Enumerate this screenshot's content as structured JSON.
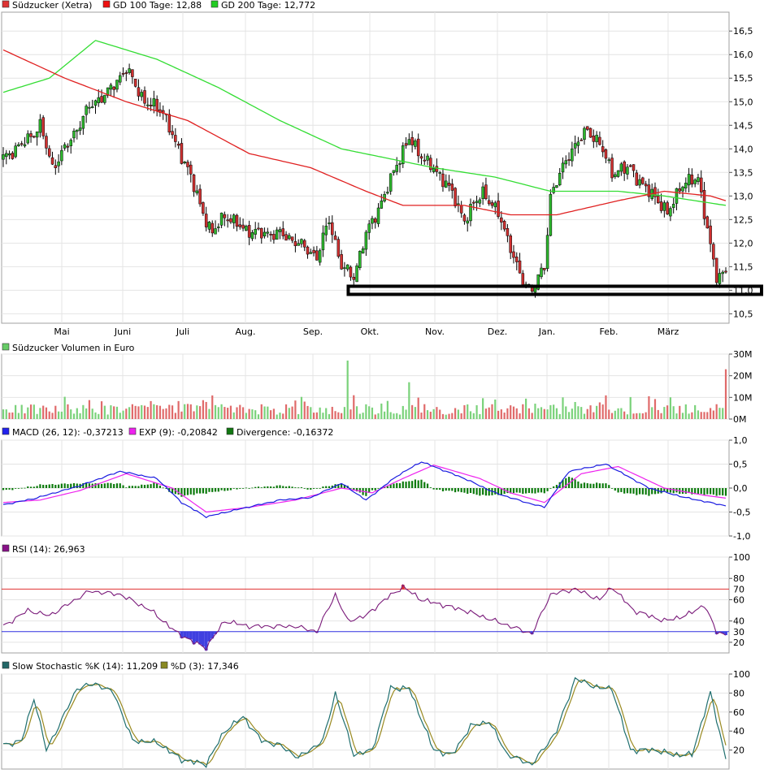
{
  "colors": {
    "price_up": "#2db82d",
    "price_down": "#d03030",
    "gd100": "#e02020",
    "gd200": "#33dd33",
    "macd": "#1a1ae0",
    "exp": "#ee22ee",
    "divergence": "#0b7a0b",
    "rsi": "#7a1a7a",
    "rsi_fill_low": "#4040e0",
    "rsi_fill_high": "#e03030",
    "stoch_k": "#1f6f6f",
    "stoch_d": "#9a8a20",
    "grid": "#e4e4e4",
    "frame": "#a0a0a0"
  },
  "legends": {
    "price": [
      {
        "swatch": "#dd3333",
        "text": "Südzucker (Xetra)"
      },
      {
        "swatch": "#ee1111",
        "text": "GD 100 Tage: 12,88"
      },
      {
        "swatch": "#22cc22",
        "text": "GD 200 Tage: 12,772"
      }
    ],
    "volume": [
      {
        "swatch": "#66cc66",
        "text": "Südzucker Volumen in Euro"
      }
    ],
    "macd": [
      {
        "swatch": "#2222ee",
        "text": "MACD (26, 12): -0,37213"
      },
      {
        "swatch": "#ee22ee",
        "text": "EXP (9): -0,20842"
      },
      {
        "swatch": "#117711",
        "text": "Divergence: -0,16372"
      }
    ],
    "rsi": [
      {
        "swatch": "#881188",
        "text": "RSI (14): 26,963"
      }
    ],
    "stoch": [
      {
        "swatch": "#226666",
        "text": "Slow Stochastic %K (14): 11,209"
      },
      {
        "swatch": "#888822",
        "text": "%D (3): 17,346"
      }
    ]
  },
  "chart_data": [
    {
      "type": "candlestick",
      "title": "Südzucker (Xetra)",
      "x_months": [
        "Mai",
        "Juni",
        "Juli",
        "Aug.",
        "Sep.",
        "Okt.",
        "Nov.",
        "Dez.",
        "Jan.",
        "Feb.",
        "März"
      ],
      "ylim": [
        10.3,
        16.9
      ],
      "y_ticks": [
        "10,5",
        "11,0",
        "11,5",
        "12,0",
        "12,5",
        "13,0",
        "13,5",
        "14,0",
        "14,5",
        "15,0",
        "15,5",
        "16,0",
        "16,5"
      ],
      "grid": true,
      "price_anchors": [
        [
          0,
          13.8
        ],
        [
          8,
          14.2
        ],
        [
          12,
          14.5
        ],
        [
          16,
          13.6
        ],
        [
          22,
          14.2
        ],
        [
          28,
          14.9
        ],
        [
          34,
          15.2
        ],
        [
          40,
          15.7
        ],
        [
          46,
          15.0
        ],
        [
          52,
          14.8
        ],
        [
          56,
          14.1
        ],
        [
          60,
          13.6
        ],
        [
          64,
          12.8
        ],
        [
          68,
          12.2
        ],
        [
          72,
          12.6
        ],
        [
          78,
          12.3
        ],
        [
          84,
          12.2
        ],
        [
          90,
          12.2
        ],
        [
          96,
          12.0
        ],
        [
          102,
          11.7
        ],
        [
          106,
          12.5
        ],
        [
          110,
          11.5
        ],
        [
          114,
          11.3
        ],
        [
          118,
          12.2
        ],
        [
          124,
          13.0
        ],
        [
          128,
          13.7
        ],
        [
          132,
          14.2
        ],
        [
          138,
          13.7
        ],
        [
          144,
          13.3
        ],
        [
          150,
          12.5
        ],
        [
          156,
          13.1
        ],
        [
          162,
          12.5
        ],
        [
          168,
          11.3
        ],
        [
          172,
          11.0
        ],
        [
          176,
          11.5
        ],
        [
          178,
          13.0
        ],
        [
          184,
          13.9
        ],
        [
          190,
          14.4
        ],
        [
          194,
          14.1
        ],
        [
          198,
          13.5
        ],
        [
          204,
          13.6
        ],
        [
          208,
          13.2
        ],
        [
          212,
          13.0
        ],
        [
          216,
          12.6
        ],
        [
          220,
          13.2
        ],
        [
          226,
          13.4
        ],
        [
          230,
          11.9
        ],
        [
          232,
          11.3
        ],
        [
          235,
          11.4
        ]
      ],
      "series": [
        {
          "name": "GD 100 Tage",
          "last": 12.88,
          "points": [
            [
              0,
              16.1
            ],
            [
              20,
              15.5
            ],
            [
              40,
              15.0
            ],
            [
              60,
              14.6
            ],
            [
              80,
              13.9
            ],
            [
              100,
              13.6
            ],
            [
              118,
              13.1
            ],
            [
              130,
              12.8
            ],
            [
              150,
              12.8
            ],
            [
              165,
              12.6
            ],
            [
              180,
              12.6
            ],
            [
              200,
              12.9
            ],
            [
              215,
              13.1
            ],
            [
              230,
              13.0
            ],
            [
              235,
              12.9
            ]
          ]
        },
        {
          "name": "GD 200 Tage",
          "last": 12.772,
          "points": [
            [
              0,
              15.2
            ],
            [
              15,
              15.5
            ],
            [
              30,
              16.3
            ],
            [
              50,
              15.9
            ],
            [
              70,
              15.3
            ],
            [
              90,
              14.6
            ],
            [
              110,
              14.0
            ],
            [
              125,
              13.8
            ],
            [
              140,
              13.6
            ],
            [
              160,
              13.4
            ],
            [
              178,
              13.1
            ],
            [
              200,
              13.1
            ],
            [
              215,
              13.0
            ],
            [
              235,
              12.8
            ]
          ]
        }
      ],
      "annotations": [
        "support box ~11,0"
      ]
    },
    {
      "type": "bar",
      "title": "Südzucker Volumen in Euro",
      "ylim": [
        0,
        30
      ],
      "y_ticks": [
        "0M",
        "10M",
        "20M",
        "30M"
      ],
      "unit": "M EUR",
      "spikes": [
        [
          112,
          27
        ],
        [
          114,
          11
        ],
        [
          132,
          17
        ],
        [
          160,
          9
        ],
        [
          182,
          10
        ],
        [
          235,
          23
        ]
      ]
    },
    {
      "type": "line",
      "title": "MACD (26, 12)",
      "ylim": [
        -1.0,
        1.0
      ],
      "y_ticks": [
        "-1,0",
        "-0,5",
        "0,0",
        "0,5",
        "1,0"
      ],
      "series": [
        {
          "name": "MACD (26, 12)",
          "last": -0.37213,
          "points": [
            [
              0,
              -0.35
            ],
            [
              10,
              -0.22
            ],
            [
              25,
              0.05
            ],
            [
              38,
              0.35
            ],
            [
              50,
              0.2
            ],
            [
              58,
              -0.3
            ],
            [
              66,
              -0.6
            ],
            [
              76,
              -0.45
            ],
            [
              90,
              -0.25
            ],
            [
              100,
              -0.2
            ],
            [
              110,
              0.1
            ],
            [
              118,
              -0.25
            ],
            [
              128,
              0.25
            ],
            [
              136,
              0.55
            ],
            [
              150,
              0.2
            ],
            [
              160,
              -0.1
            ],
            [
              170,
              -0.3
            ],
            [
              176,
              -0.4
            ],
            [
              184,
              0.35
            ],
            [
              196,
              0.5
            ],
            [
              210,
              0.0
            ],
            [
              222,
              -0.2
            ],
            [
              235,
              -0.37
            ]
          ]
        },
        {
          "name": "EXP (9)",
          "last": -0.20842,
          "points": [
            [
              0,
              -0.3
            ],
            [
              12,
              -0.25
            ],
            [
              25,
              -0.05
            ],
            [
              40,
              0.3
            ],
            [
              55,
              0.0
            ],
            [
              66,
              -0.5
            ],
            [
              80,
              -0.4
            ],
            [
              95,
              -0.25
            ],
            [
              110,
              0.0
            ],
            [
              120,
              -0.1
            ],
            [
              130,
              0.2
            ],
            [
              140,
              0.48
            ],
            [
              155,
              0.2
            ],
            [
              165,
              -0.1
            ],
            [
              176,
              -0.3
            ],
            [
              188,
              0.3
            ],
            [
              200,
              0.45
            ],
            [
              215,
              0.0
            ],
            [
              228,
              -0.15
            ],
            [
              235,
              -0.21
            ]
          ]
        },
        {
          "name": "Divergence",
          "last": -0.16372
        }
      ]
    },
    {
      "type": "line",
      "title": "RSI (14)",
      "ylim": [
        10,
        100
      ],
      "y_ticks": [
        "20",
        "40",
        "60",
        "80",
        "100"
      ],
      "reference_lines": [
        70,
        30
      ],
      "reference_labels": [
        "70",
        "30"
      ],
      "series": [
        {
          "name": "RSI (14)",
          "last": 26.963,
          "points": [
            [
              0,
              35
            ],
            [
              8,
              50
            ],
            [
              15,
              45
            ],
            [
              28,
              68
            ],
            [
              38,
              65
            ],
            [
              48,
              50
            ],
            [
              56,
              30
            ],
            [
              62,
              20
            ],
            [
              66,
              15
            ],
            [
              72,
              40
            ],
            [
              80,
              35
            ],
            [
              95,
              35
            ],
            [
              102,
              30
            ],
            [
              108,
              65
            ],
            [
              112,
              40
            ],
            [
              118,
              45
            ],
            [
              124,
              60
            ],
            [
              130,
              72
            ],
            [
              136,
              60
            ],
            [
              150,
              50
            ],
            [
              160,
              40
            ],
            [
              172,
              28
            ],
            [
              178,
              65
            ],
            [
              186,
              70
            ],
            [
              194,
              60
            ],
            [
              198,
              72
            ],
            [
              205,
              50
            ],
            [
              215,
              40
            ],
            [
              222,
              45
            ],
            [
              228,
              55
            ],
            [
              232,
              30
            ],
            [
              235,
              27
            ]
          ]
        }
      ]
    },
    {
      "type": "line",
      "title": "Slow Stochastic",
      "ylim": [
        0,
        100
      ],
      "y_ticks": [
        "20",
        "40",
        "60",
        "80",
        "100"
      ],
      "series": [
        {
          "name": "Slow Stochastic %K (14)",
          "last": 11.209,
          "points": [
            [
              0,
              25
            ],
            [
              6,
              30
            ],
            [
              10,
              75
            ],
            [
              14,
              20
            ],
            [
              18,
              45
            ],
            [
              24,
              85
            ],
            [
              30,
              90
            ],
            [
              36,
              80
            ],
            [
              42,
              30
            ],
            [
              50,
              28
            ],
            [
              58,
              10
            ],
            [
              66,
              5
            ],
            [
              72,
              40
            ],
            [
              78,
              55
            ],
            [
              84,
              30
            ],
            [
              90,
              25
            ],
            [
              96,
              12
            ],
            [
              104,
              30
            ],
            [
              108,
              80
            ],
            [
              114,
              15
            ],
            [
              120,
              20
            ],
            [
              126,
              85
            ],
            [
              132,
              85
            ],
            [
              140,
              20
            ],
            [
              146,
              15
            ],
            [
              152,
              45
            ],
            [
              158,
              50
            ],
            [
              164,
              15
            ],
            [
              172,
              5
            ],
            [
              180,
              40
            ],
            [
              186,
              95
            ],
            [
              194,
              85
            ],
            [
              198,
              85
            ],
            [
              204,
              20
            ],
            [
              212,
              20
            ],
            [
              218,
              15
            ],
            [
              224,
              15
            ],
            [
              230,
              80
            ],
            [
              235,
              11
            ]
          ]
        },
        {
          "name": "%D (3)",
          "last": 17.346
        }
      ]
    }
  ]
}
